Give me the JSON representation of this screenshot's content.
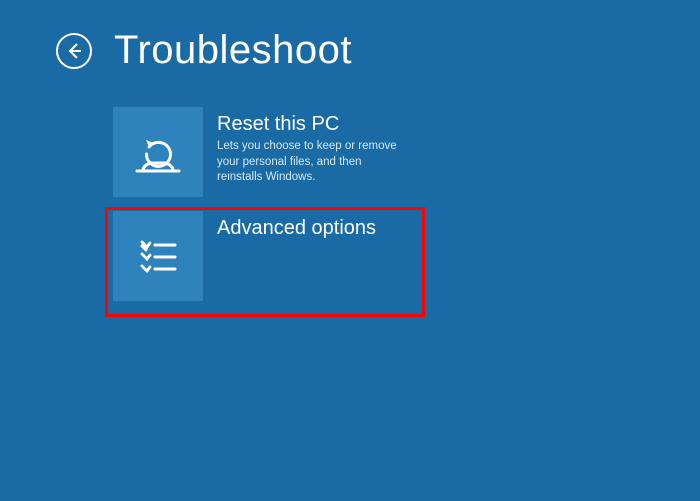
{
  "page": {
    "title": "Troubleshoot"
  },
  "options": [
    {
      "icon": "reset-pc-icon",
      "title": "Reset this PC",
      "description": "Lets you choose to keep or remove your personal files, and then reinstalls Windows."
    },
    {
      "icon": "advanced-options-icon",
      "title": "Advanced options",
      "description": ""
    }
  ]
}
